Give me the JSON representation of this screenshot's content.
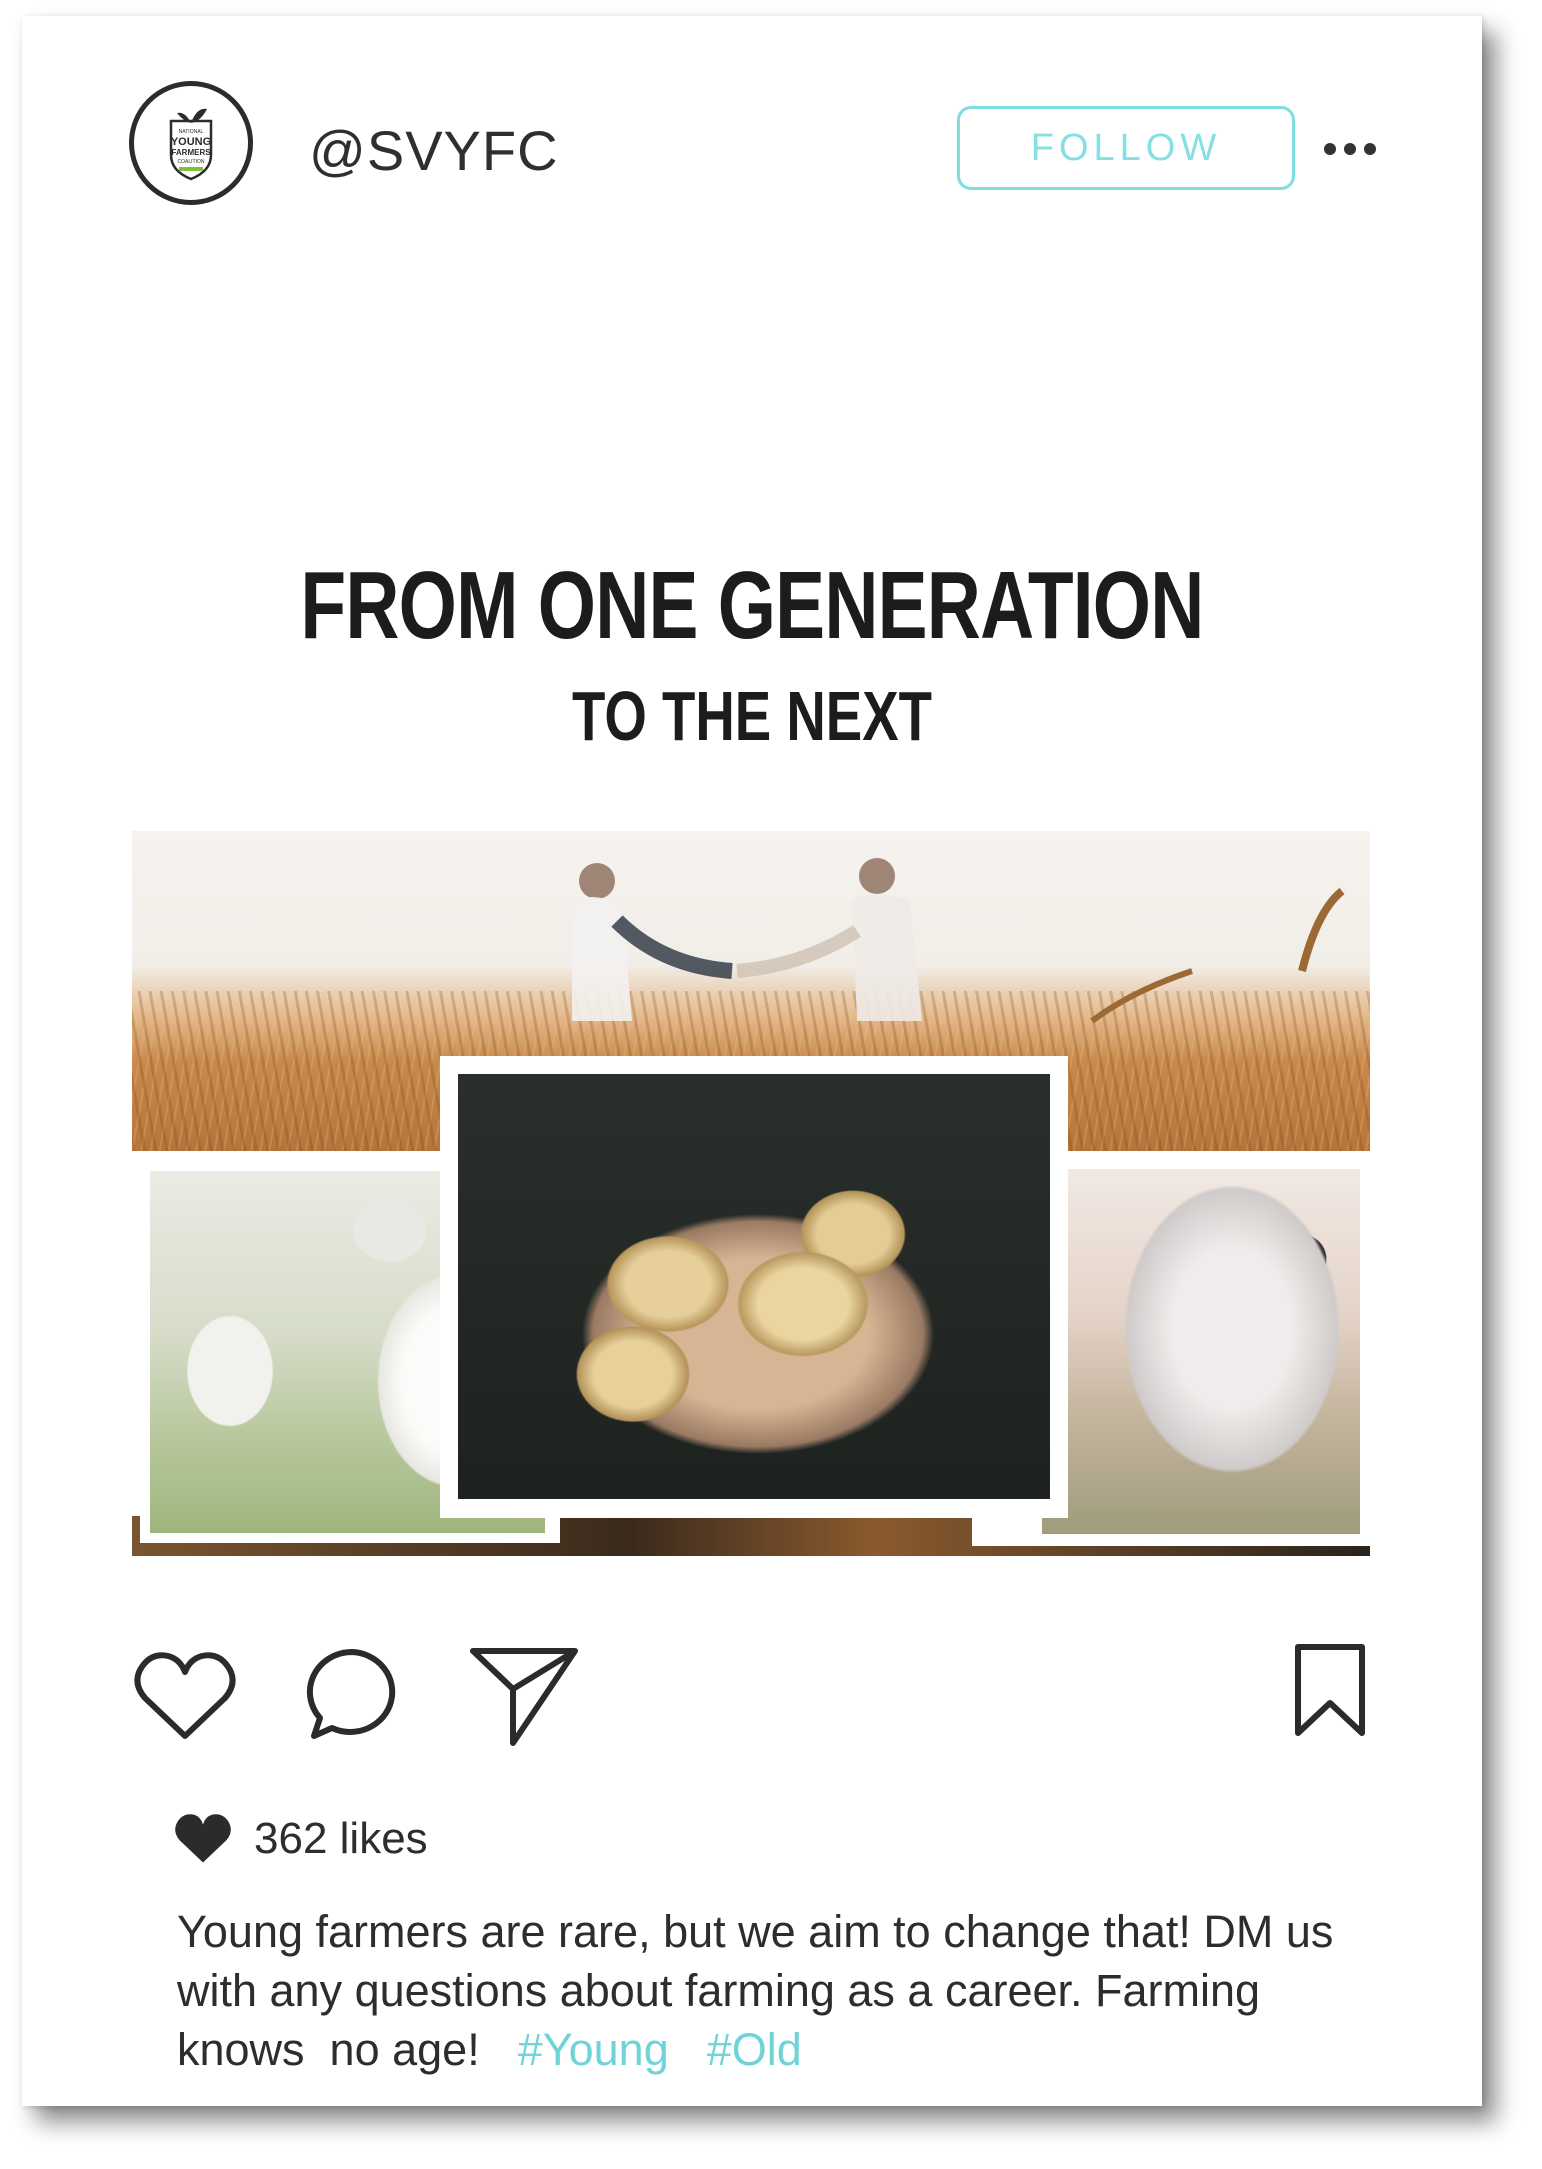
{
  "header": {
    "handle": "@SVYFC",
    "follow_label": "FOLLOW",
    "avatar_alt": "NATIONAL YOUNG FARMERS COALITION",
    "logo_lines": [
      "NATIONAL",
      "YOUNG",
      "FARMERS",
      "COALITION"
    ]
  },
  "post": {
    "headline": "FROM ONE GENERATION",
    "subheadline": "TO THE NEXT",
    "images": [
      "handshake-in-wheat-field",
      "sheep",
      "potatoes-in-hands",
      "cow"
    ]
  },
  "actions": {
    "icons": [
      "heart-icon",
      "comment-icon",
      "share-icon",
      "bookmark-icon"
    ],
    "likes": "362 likes"
  },
  "caption": {
    "text": "Young farmers are rare, but we aim to change that! DM us with any questions about farming as a career. Farming knows  no age!",
    "tags": [
      "#Young",
      "#Old"
    ]
  },
  "colors": {
    "accent": "#7fdce0",
    "text": "#2d2d2d",
    "headline": "#1c1c1c"
  }
}
